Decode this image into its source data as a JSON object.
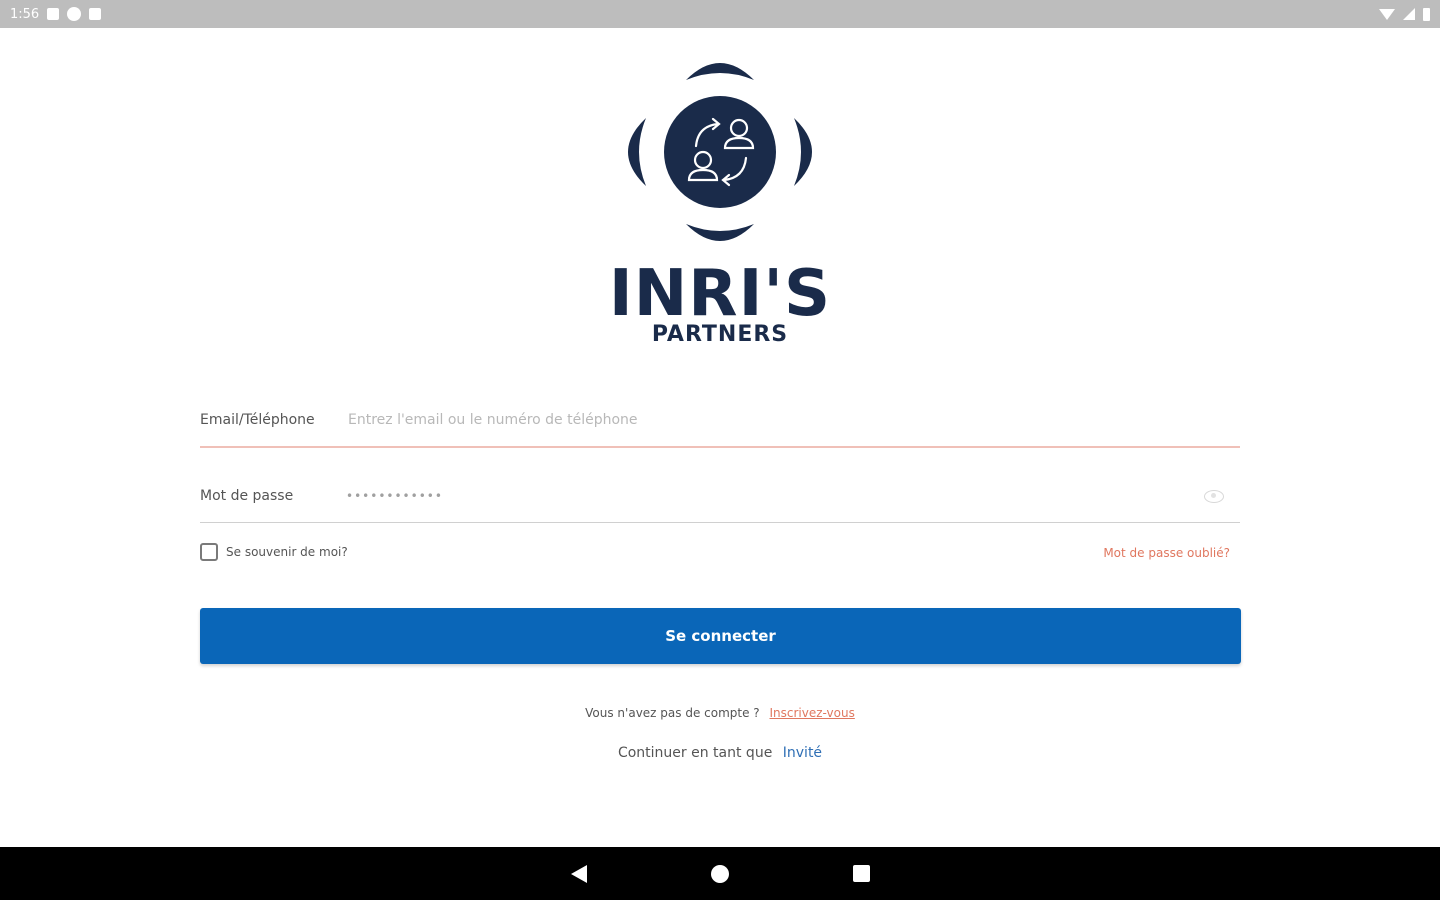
{
  "status_bar": {
    "time": "1:56",
    "icons": [
      "notification-icon",
      "app-icon",
      "sd-card-icon",
      "wifi-icon",
      "signal-icon",
      "battery-icon"
    ]
  },
  "brand": {
    "name": "INRI'S",
    "subtitle": "PARTNERS",
    "color": "#1a2b4a"
  },
  "form": {
    "email_label": "Email/Téléphone",
    "email_placeholder": "Entrez l'email ou le numéro de téléphone",
    "password_label": "Mot de passe",
    "password_value": "••••••••••••",
    "remember_label": "Se souvenir de moi?",
    "forgot_label": "Mot de passe oublié?",
    "submit_label": "Se connecter"
  },
  "footer": {
    "signup_prompt": "Vous n'avez pas de compte ?",
    "signup_link": "Inscrivez-vous",
    "guest_prompt": "Continuer en tant que",
    "guest_link": "Invité"
  },
  "colors": {
    "primary": "#0a66b8",
    "accent": "#e0775f",
    "link": "#2f6fb5"
  },
  "nav_bar": {
    "icons": [
      "back-icon",
      "home-icon",
      "recent-apps-icon"
    ]
  }
}
